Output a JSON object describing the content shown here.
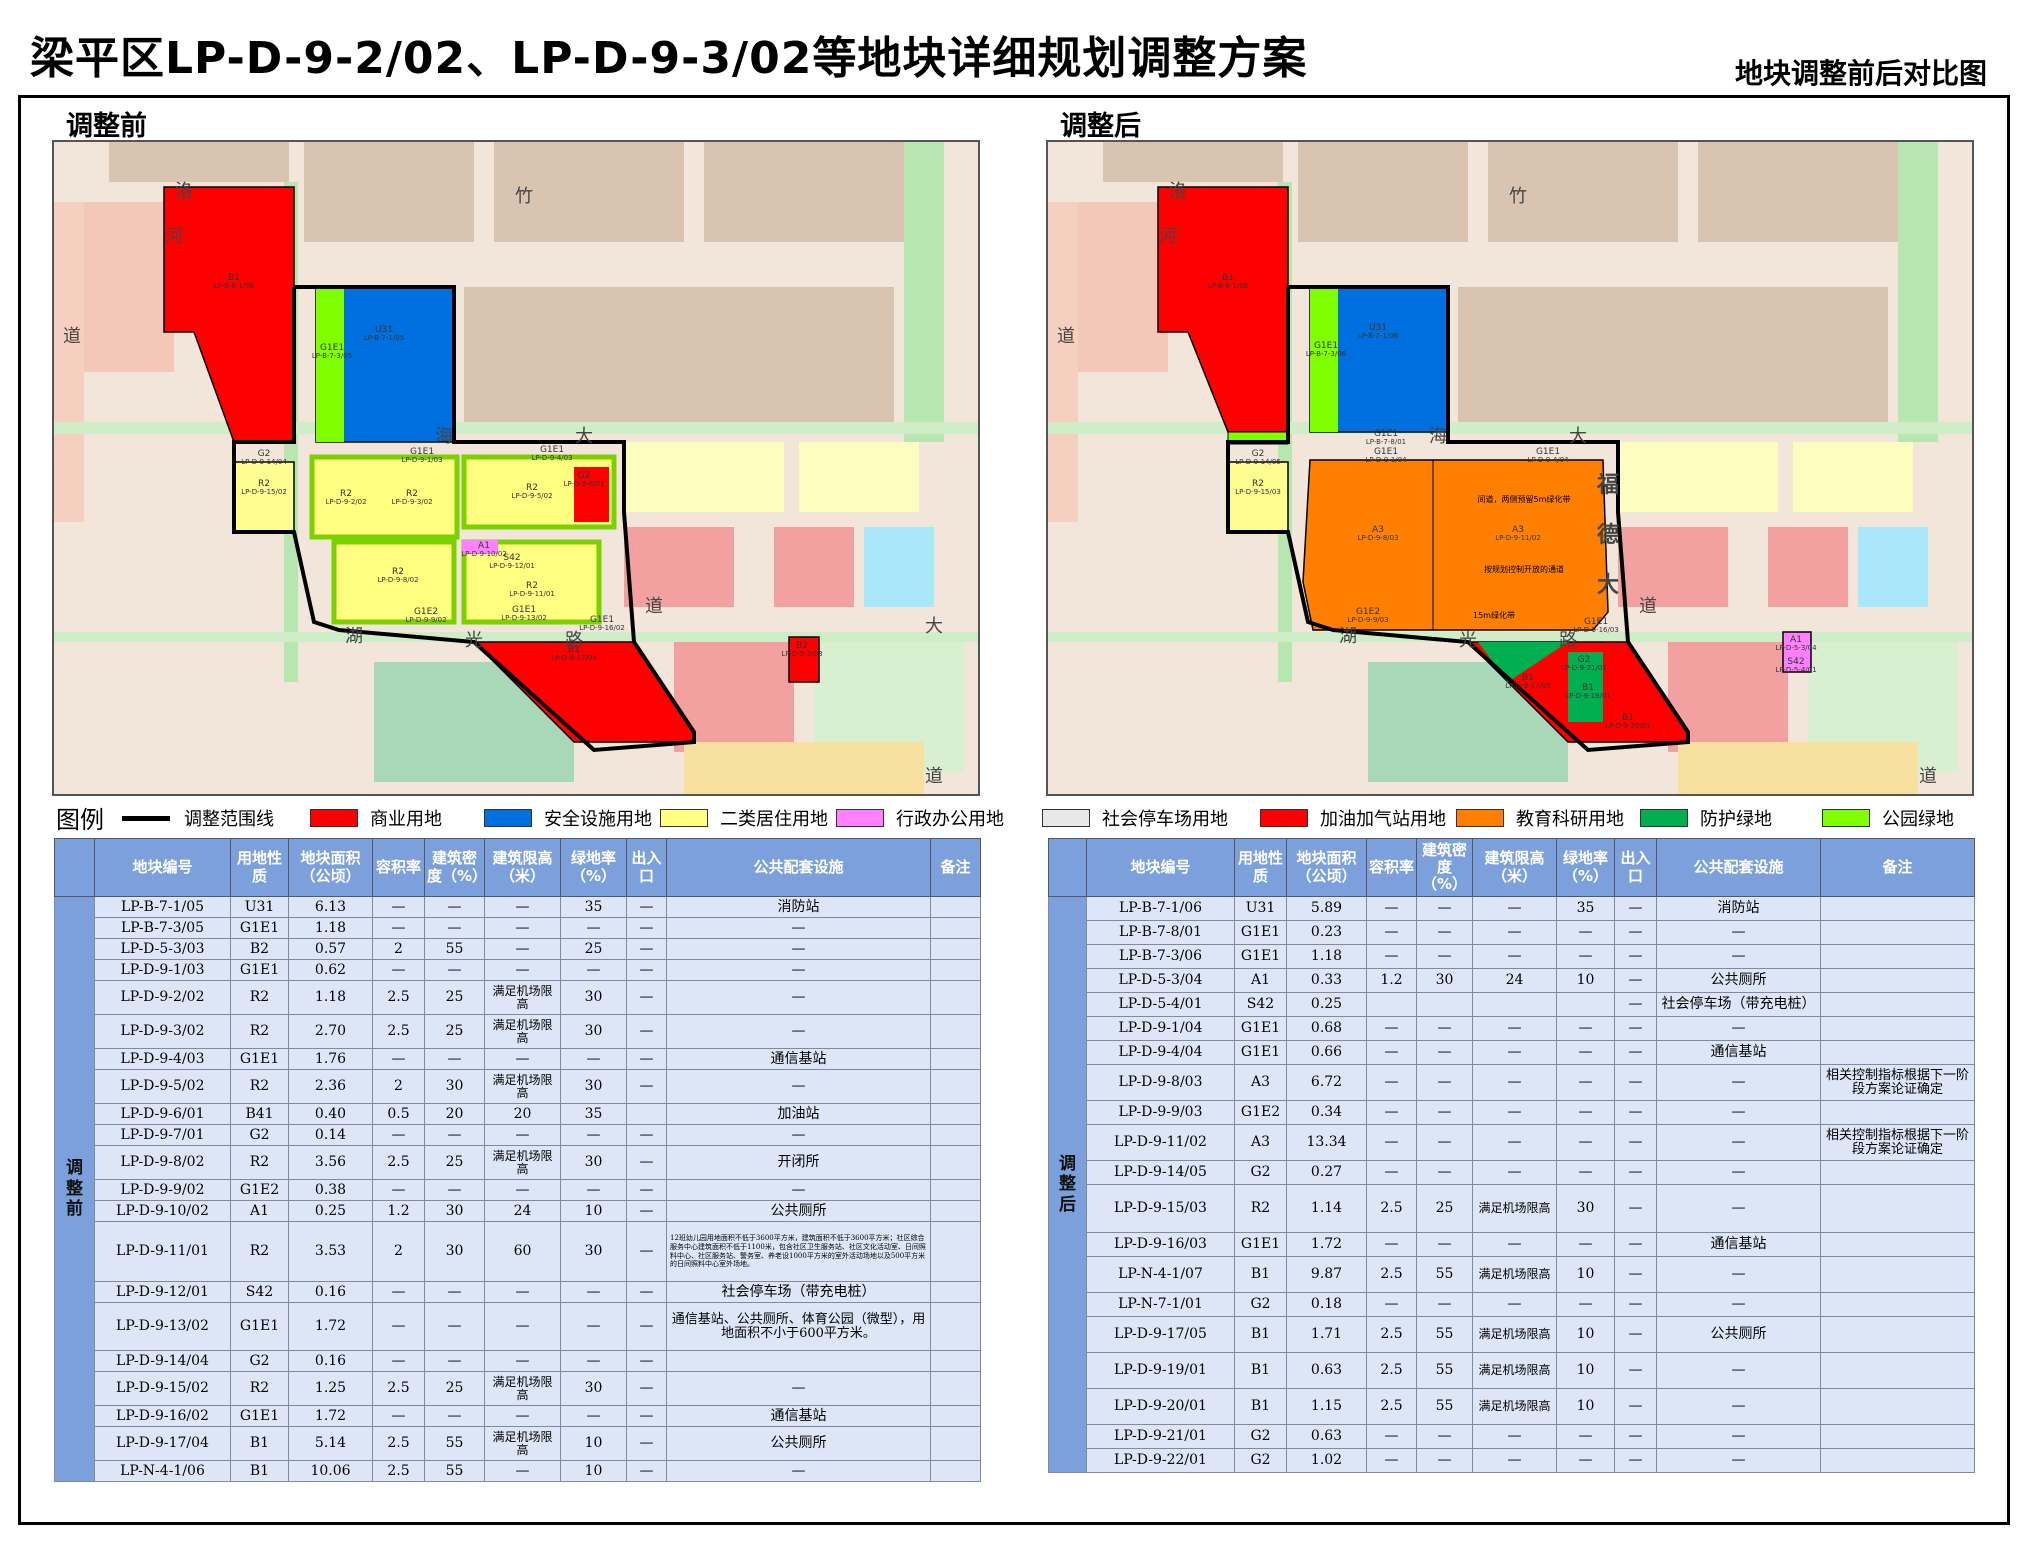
{
  "header": {
    "title": "梁平区LP-D-9-2/02、LP-D-9-3/02等地块详细规划调整方案",
    "subtitle": "地块调整前后对比图"
  },
  "panels": {
    "before_title": "调整前",
    "after_title": "调整后"
  },
  "map_before": {
    "labels": [
      {
        "text": "B1"
      },
      {
        "text": "LP-B-8-1/06"
      },
      {
        "text": "U31"
      },
      {
        "text": "LP-B-7-1/05"
      },
      {
        "text": "G1E1"
      },
      {
        "text": "LP-B-7-3/05"
      },
      {
        "text": "G2"
      },
      {
        "text": "LP-D-9-14/04"
      },
      {
        "text": "R2"
      },
      {
        "text": "LP-D-9-15/02"
      },
      {
        "text": "R2"
      },
      {
        "text": "LP-D-9-2/02"
      },
      {
        "text": "R2"
      },
      {
        "text": "LP-D-9-3/02"
      },
      {
        "text": "R2"
      },
      {
        "text": "LP-D-9-5/02"
      },
      {
        "text": "R2"
      },
      {
        "text": "LP-D-9-8/02"
      },
      {
        "text": "R2"
      },
      {
        "text": "LP-D-9-11/01"
      },
      {
        "text": "A1"
      },
      {
        "text": "LP-D-9-10/02"
      },
      {
        "text": "S42"
      },
      {
        "text": "LP-D-9-12/01"
      },
      {
        "text": "G1E2"
      },
      {
        "text": "LP-D-9-9/02"
      },
      {
        "text": "G1E1"
      },
      {
        "text": "LP-D-9-13/02"
      },
      {
        "text": "G1E1"
      },
      {
        "text": "LP-D-9-16/02"
      },
      {
        "text": "B1"
      },
      {
        "text": "LP-D-9-17/04"
      },
      {
        "text": "B2"
      },
      {
        "text": "LP-D-5-3/03"
      },
      {
        "text": "G1E1"
      },
      {
        "text": "LP-D-9-1/03"
      },
      {
        "text": "G1E1"
      },
      {
        "text": "LP-D-9-4/03"
      },
      {
        "text": "G2"
      },
      {
        "text": "LP-D-9-6/01"
      }
    ],
    "roads": [
      {
        "text": "道"
      },
      {
        "text": "洛"
      },
      {
        "text": "河"
      },
      {
        "text": "竹"
      },
      {
        "text": "海"
      },
      {
        "text": "大"
      },
      {
        "text": "道"
      },
      {
        "text": "湖"
      },
      {
        "text": "光"
      },
      {
        "text": "路"
      },
      {
        "text": "大"
      },
      {
        "text": "道"
      }
    ]
  },
  "map_after": {
    "labels": [
      {
        "text": "B1"
      },
      {
        "text": "LP-B-8-1/06"
      },
      {
        "text": "U31"
      },
      {
        "text": "LP-B-7-1/06"
      },
      {
        "text": "G1E1"
      },
      {
        "text": "LP-B-7-3/06"
      },
      {
        "text": "G1E1"
      },
      {
        "text": "LP-B-7-8/01"
      },
      {
        "text": "G2"
      },
      {
        "text": "LP-D-9-14/05"
      },
      {
        "text": "R2"
      },
      {
        "text": "LP-D-9-15/03"
      },
      {
        "text": "A3"
      },
      {
        "text": "LP-D-9-8/03"
      },
      {
        "text": "A3"
      },
      {
        "text": "LP-D-9-11/02"
      },
      {
        "text": "G1E2"
      },
      {
        "text": "LP-D-9-9/03"
      },
      {
        "text": "G1E1"
      },
      {
        "text": "LP-D-9-16/03"
      },
      {
        "text": "B1"
      },
      {
        "text": "LP-D-9-17/05"
      },
      {
        "text": "B1"
      },
      {
        "text": "LP-D-9-19/01"
      },
      {
        "text": "B1"
      },
      {
        "text": "LP-D-9-20/01"
      },
      {
        "text": "G2"
      },
      {
        "text": "LP-D-9-21/01"
      },
      {
        "text": "A1"
      },
      {
        "text": "LP-D-5-3/04"
      },
      {
        "text": "S42"
      },
      {
        "text": "LP-D-5-4/01"
      },
      {
        "text": "G1E1"
      },
      {
        "text": "LP-D-9-1/04"
      },
      {
        "text": "G1E1"
      },
      {
        "text": "LP-D-9-4/04"
      }
    ],
    "notes": [
      {
        "text": "间道，两侧预留5m绿化带"
      },
      {
        "text": "按规划控制开放的通道"
      },
      {
        "text": "15m绿化带"
      }
    ],
    "roads": [
      {
        "text": "道"
      },
      {
        "text": "洛"
      },
      {
        "text": "河"
      },
      {
        "text": "竹"
      },
      {
        "text": "海"
      },
      {
        "text": "大"
      },
      {
        "text": "道"
      },
      {
        "text": "湖"
      },
      {
        "text": "光"
      },
      {
        "text": "路"
      },
      {
        "text": "福"
      },
      {
        "text": "德"
      },
      {
        "text": "大"
      },
      {
        "text": "道"
      }
    ]
  },
  "legend": {
    "title": "图例",
    "items": [
      {
        "label": "调整范围线",
        "color": "#000000",
        "kind": "line"
      },
      {
        "label": "商业用地",
        "color": "#ff0000",
        "kind": "swatch"
      },
      {
        "label": "安全设施用地",
        "color": "#0070e0",
        "kind": "swatch"
      },
      {
        "label": "二类居住用地",
        "color": "#ffff80",
        "kind": "swatch"
      },
      {
        "label": "行政办公用地",
        "color": "#ff80ff",
        "kind": "swatch"
      },
      {
        "label": "社会停车场用地",
        "color": "#e8e8e8",
        "kind": "swatch"
      },
      {
        "label": "加油加气站用地",
        "color": "#ff0000",
        "kind": "swatch"
      },
      {
        "label": "教育科研用地",
        "color": "#ff8000",
        "kind": "swatch"
      },
      {
        "label": "防护绿地",
        "color": "#00b050",
        "kind": "swatch"
      },
      {
        "label": "公园绿地",
        "color": "#80ff00",
        "kind": "swatch"
      }
    ]
  },
  "table_headers": [
    "",
    "地块编号",
    "用地性质",
    "地块面积（公顷）",
    "容积率",
    "建筑密度（%）",
    "建筑限高（米）",
    "绿地率（%）",
    "出入口",
    "公共配套设施",
    "备注"
  ],
  "table_before": {
    "group_label": "调整前",
    "rows": [
      [
        "LP-B-7-1/05",
        "U31",
        "6.13",
        "—",
        "—",
        "—",
        "35",
        "—",
        "消防站",
        ""
      ],
      [
        "LP-B-7-3/05",
        "G1E1",
        "1.18",
        "—",
        "—",
        "—",
        "—",
        "—",
        "—",
        ""
      ],
      [
        "LP-D-5-3/03",
        "B2",
        "0.57",
        "2",
        "55",
        "—",
        "25",
        "—",
        "—",
        ""
      ],
      [
        "LP-D-9-1/03",
        "G1E1",
        "0.62",
        "—",
        "—",
        "—",
        "—",
        "—",
        "—",
        ""
      ],
      [
        "LP-D-9-2/02",
        "R2",
        "1.18",
        "2.5",
        "25",
        "满足机场限高",
        "30",
        "—",
        "—",
        ""
      ],
      [
        "LP-D-9-3/02",
        "R2",
        "2.70",
        "2.5",
        "25",
        "满足机场限高",
        "30",
        "—",
        "—",
        ""
      ],
      [
        "LP-D-9-4/03",
        "G1E1",
        "1.76",
        "—",
        "—",
        "—",
        "—",
        "—",
        "通信基站",
        ""
      ],
      [
        "LP-D-9-5/02",
        "R2",
        "2.36",
        "2",
        "30",
        "满足机场限高",
        "30",
        "—",
        "—",
        ""
      ],
      [
        "LP-D-9-6/01",
        "B41",
        "0.40",
        "0.5",
        "20",
        "20",
        "35",
        "",
        "加油站",
        ""
      ],
      [
        "LP-D-9-7/01",
        "G2",
        "0.14",
        "—",
        "—",
        "—",
        "—",
        "—",
        "—",
        ""
      ],
      [
        "LP-D-9-8/02",
        "R2",
        "3.56",
        "2.5",
        "25",
        "满足机场限高",
        "30",
        "—",
        "开闭所",
        ""
      ],
      [
        "LP-D-9-9/02",
        "G1E2",
        "0.38",
        "—",
        "—",
        "—",
        "—",
        "—",
        "—",
        ""
      ],
      [
        "LP-D-9-10/02",
        "A1",
        "0.25",
        "1.2",
        "30",
        "24",
        "10",
        "—",
        "公共厕所",
        ""
      ],
      [
        "LP-D-9-11/01",
        "R2",
        "3.53",
        "2",
        "30",
        "60",
        "30",
        "—",
        "12班幼儿园用地面积不低于3600平方米，建筑面积不低于3600平方米；社区综合服务中心建筑面积不低于1100米，包含社区卫生服务站、社区文化活动室、日间照料中心、社区服务站、警务室、养老设1000平方米的室外活动场地以及500平方米的日间照料中心室外场地。",
        ""
      ],
      [
        "LP-D-9-12/01",
        "S42",
        "0.16",
        "—",
        "—",
        "—",
        "—",
        "—",
        "社会停车场（带充电桩）",
        ""
      ],
      [
        "LP-D-9-13/02",
        "G1E1",
        "1.72",
        "—",
        "—",
        "—",
        "—",
        "—",
        "通信基站、公共厕所、体育公园（微型），用地面积不小于600平方米。",
        ""
      ],
      [
        "LP-D-9-14/04",
        "G2",
        "0.16",
        "—",
        "—",
        "—",
        "—",
        "—",
        "",
        ""
      ],
      [
        "LP-D-9-15/02",
        "R2",
        "1.25",
        "2.5",
        "25",
        "满足机场限高",
        "30",
        "—",
        "—",
        ""
      ],
      [
        "LP-D-9-16/02",
        "G1E1",
        "1.72",
        "—",
        "—",
        "—",
        "—",
        "—",
        "通信基站",
        ""
      ],
      [
        "LP-D-9-17/04",
        "B1",
        "5.14",
        "2.5",
        "55",
        "满足机场限高",
        "10",
        "—",
        "公共厕所",
        ""
      ],
      [
        "LP-N-4-1/06",
        "B1",
        "10.06",
        "2.5",
        "55",
        "—",
        "10",
        "—",
        "—",
        ""
      ]
    ]
  },
  "table_after": {
    "group_label": "调整后",
    "rows": [
      [
        "LP-B-7-1/06",
        "U31",
        "5.89",
        "—",
        "—",
        "—",
        "35",
        "—",
        "消防站",
        ""
      ],
      [
        "LP-B-7-8/01",
        "G1E1",
        "0.23",
        "—",
        "—",
        "—",
        "—",
        "—",
        "—",
        ""
      ],
      [
        "LP-B-7-3/06",
        "G1E1",
        "1.18",
        "—",
        "—",
        "—",
        "—",
        "—",
        "—",
        ""
      ],
      [
        "LP-D-5-3/04",
        "A1",
        "0.33",
        "1.2",
        "30",
        "24",
        "10",
        "—",
        "公共厕所",
        ""
      ],
      [
        "LP-D-5-4/01",
        "S42",
        "0.25",
        "",
        "",
        "",
        "",
        "—",
        "社会停车场（带充电桩）",
        ""
      ],
      [
        "LP-D-9-1/04",
        "G1E1",
        "0.68",
        "—",
        "—",
        "—",
        "—",
        "—",
        "—",
        ""
      ],
      [
        "LP-D-9-4/04",
        "G1E1",
        "0.66",
        "—",
        "—",
        "—",
        "—",
        "—",
        "通信基站",
        ""
      ],
      [
        "LP-D-9-8/03",
        "A3",
        "6.72",
        "—",
        "—",
        "—",
        "—",
        "—",
        "—",
        "相关控制指标根据下一阶段方案论证确定"
      ],
      [
        "LP-D-9-9/03",
        "G1E2",
        "0.34",
        "—",
        "—",
        "—",
        "—",
        "—",
        "—",
        ""
      ],
      [
        "LP-D-9-11/02",
        "A3",
        "13.34",
        "—",
        "—",
        "—",
        "—",
        "—",
        "—",
        "相关控制指标根据下一阶段方案论证确定"
      ],
      [
        "LP-D-9-14/05",
        "G2",
        "0.27",
        "—",
        "—",
        "—",
        "—",
        "—",
        "—",
        ""
      ],
      [
        "LP-D-9-15/03",
        "R2",
        "1.14",
        "2.5",
        "25",
        "满足机场限高",
        "30",
        "—",
        "—",
        ""
      ],
      [
        "LP-D-9-16/03",
        "G1E1",
        "1.72",
        "—",
        "—",
        "—",
        "—",
        "—",
        "通信基站",
        ""
      ],
      [
        "LP-N-4-1/07",
        "B1",
        "9.87",
        "2.5",
        "55",
        "满足机场限高",
        "10",
        "—",
        "—",
        ""
      ],
      [
        "LP-N-7-1/01",
        "G2",
        "0.18",
        "—",
        "—",
        "—",
        "—",
        "—",
        "—",
        ""
      ],
      [
        "LP-D-9-17/05",
        "B1",
        "1.71",
        "2.5",
        "55",
        "满足机场限高",
        "10",
        "—",
        "公共厕所",
        ""
      ],
      [
        "LP-D-9-19/01",
        "B1",
        "0.63",
        "2.5",
        "55",
        "满足机场限高",
        "10",
        "—",
        "—",
        ""
      ],
      [
        "LP-D-9-20/01",
        "B1",
        "1.15",
        "2.5",
        "55",
        "满足机场限高",
        "10",
        "—",
        "—",
        ""
      ],
      [
        "LP-D-9-21/01",
        "G2",
        "0.63",
        "—",
        "—",
        "—",
        "—",
        "—",
        "—",
        ""
      ],
      [
        "LP-D-9-22/01",
        "G2",
        "1.02",
        "—",
        "—",
        "—",
        "—",
        "—",
        "—",
        ""
      ]
    ]
  }
}
